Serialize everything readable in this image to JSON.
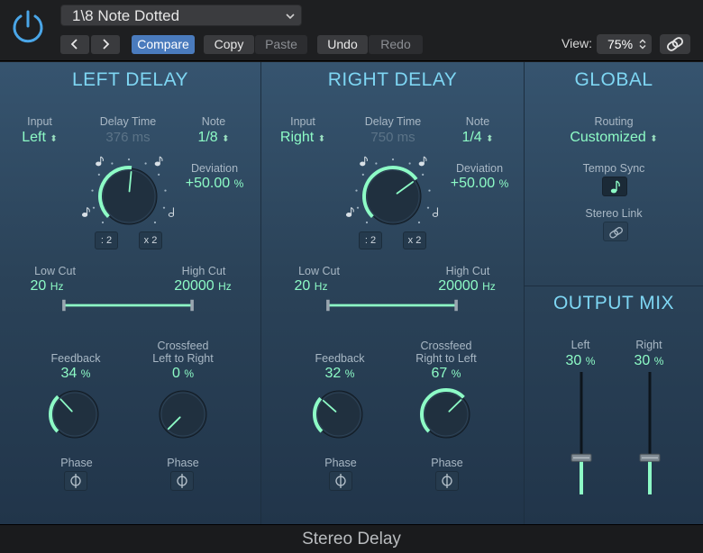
{
  "header": {
    "preset_name": "1\\8 Note Dotted",
    "compare_label": "Compare",
    "copy_label": "Copy",
    "paste_label": "Paste",
    "undo_label": "Undo",
    "redo_label": "Redo",
    "view_label": "View:",
    "view_value": "75%"
  },
  "left_delay": {
    "title": "LEFT DELAY",
    "input_label": "Input",
    "input_value": "Left",
    "delay_time_label": "Delay Time",
    "delay_time_value": "376 ms",
    "note_label": "Note",
    "note_value": "1/8",
    "deviation_label": "Deviation",
    "deviation_value": "+50.00",
    "deviation_unit": "%",
    "half_label": ": 2",
    "double_label": "x 2",
    "low_cut_label": "Low Cut",
    "low_cut_value": "20",
    "low_cut_unit": "Hz",
    "high_cut_label": "High Cut",
    "high_cut_value": "20000",
    "high_cut_unit": "Hz",
    "feedback_label": "Feedback",
    "feedback_value": "34",
    "feedback_unit": "%",
    "feedback_level": 0.34,
    "crossfeed_label_1": "Crossfeed",
    "crossfeed_label_2": "Left to Right",
    "crossfeed_value": "0",
    "crossfeed_unit": "%",
    "crossfeed_level": 0.0,
    "phase_label_a": "Phase",
    "phase_label_b": "Phase",
    "delay_knob_level": 0.52
  },
  "right_delay": {
    "title": "RIGHT DELAY",
    "input_label": "Input",
    "input_value": "Right",
    "delay_time_label": "Delay Time",
    "delay_time_value": "750 ms",
    "note_label": "Note",
    "note_value": "1/4",
    "deviation_label": "Deviation",
    "deviation_value": "+50.00",
    "deviation_unit": "%",
    "half_label": ": 2",
    "double_label": "x 2",
    "low_cut_label": "Low Cut",
    "low_cut_value": "20",
    "low_cut_unit": "Hz",
    "high_cut_label": "High Cut",
    "high_cut_value": "20000",
    "high_cut_unit": "Hz",
    "feedback_label": "Feedback",
    "feedback_value": "32",
    "feedback_unit": "%",
    "feedback_level": 0.32,
    "crossfeed_label_1": "Crossfeed",
    "crossfeed_label_2": "Right to Left",
    "crossfeed_value": "67",
    "crossfeed_unit": "%",
    "crossfeed_level": 0.67,
    "phase_label_a": "Phase",
    "phase_label_b": "Phase",
    "delay_knob_level": 0.7
  },
  "global": {
    "title": "GLOBAL",
    "routing_label": "Routing",
    "routing_value": "Customized",
    "tempo_sync_label": "Tempo Sync",
    "stereo_link_label": "Stereo Link"
  },
  "output_mix": {
    "title": "OUTPUT MIX",
    "left_label": "Left",
    "left_value": "30",
    "left_unit": "%",
    "left_level": 0.3,
    "right_label": "Right",
    "right_value": "30",
    "right_unit": "%",
    "right_level": 0.3
  },
  "footer": {
    "plugin_name": "Stereo Delay"
  },
  "colors": {
    "accent_green": "#8dfbc6",
    "section_title": "#7ed6f3",
    "compare_blue": "#4a7bbd"
  }
}
